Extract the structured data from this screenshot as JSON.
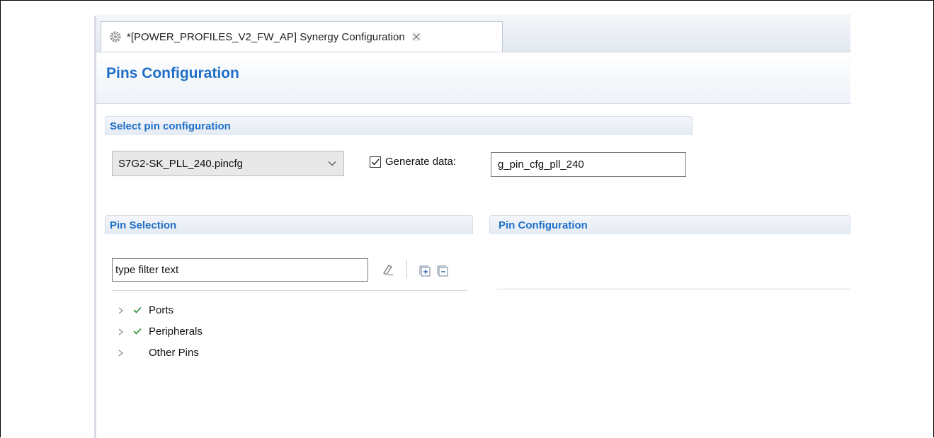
{
  "window": {
    "tab_title": "*[POWER_PROFILES_V2_FW_AP] Synergy Configuration"
  },
  "header": {
    "title": "Pins Configuration"
  },
  "select_section": {
    "title": "Select pin configuration",
    "config_file": "S7G2-SK_PLL_240.pincfg",
    "generate_data_label": "Generate data:",
    "generate_data_checked": true,
    "generate_data_value": "g_pin_cfg_pll_240"
  },
  "pin_selection": {
    "title": "Pin Selection",
    "filter_placeholder": "type filter text",
    "tree": [
      {
        "label": "Ports",
        "checked": true
      },
      {
        "label": "Peripherals",
        "checked": true
      },
      {
        "label": "Other Pins",
        "checked": false
      }
    ]
  },
  "pin_configuration": {
    "title": "Pin Configuration"
  },
  "colors": {
    "accent": "#1f6fc7",
    "check_green": "#2e8b3a"
  },
  "icons": {
    "tab": "gear-icon",
    "tab_close": "close-icon",
    "combo": "chevron-down-icon",
    "clear_filter": "eraser-icon",
    "expand_all": "expand-all-icon",
    "collapse_all": "collapse-all-icon",
    "tree_expander": "chevron-right-icon",
    "tree_status": "checkmark-icon"
  }
}
